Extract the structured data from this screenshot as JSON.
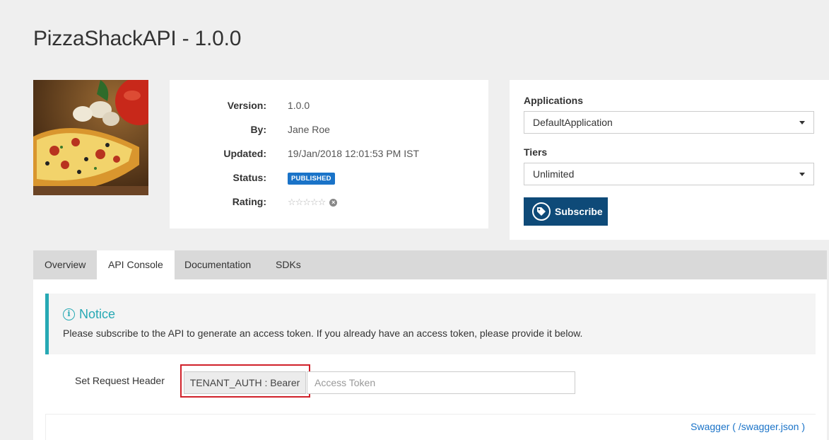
{
  "page": {
    "title": "PizzaShackAPI - 1.0.0"
  },
  "info": {
    "rows": [
      {
        "label": "Version:",
        "value": "1.0.0"
      },
      {
        "label": "By:",
        "value": "Jane Roe"
      },
      {
        "label": "Updated:",
        "value": "19/Jan/2018 12:01:53 PM IST"
      },
      {
        "label": "Status:",
        "value": "PUBLISHED"
      },
      {
        "label": "Rating:",
        "value": "☆☆☆☆☆"
      }
    ],
    "rating_stars": 0,
    "status_color": "#1a73c8"
  },
  "subscribe": {
    "applications_label": "Applications",
    "applications_value": "DefaultApplication",
    "tiers_label": "Tiers",
    "tiers_value": "Unlimited",
    "button_label": "Subscribe",
    "button_color": "#0e4a78"
  },
  "tabs": [
    {
      "label": "Overview",
      "active": false
    },
    {
      "label": "API Console",
      "active": true
    },
    {
      "label": "Documentation",
      "active": false
    },
    {
      "label": "SDKs",
      "active": false
    }
  ],
  "notice": {
    "title": "Notice",
    "text": "Please subscribe to the API to generate an access token. If you already have an access token, please provide it below.",
    "accent_color": "#27a9b4"
  },
  "request_header": {
    "label": "Set Request Header",
    "auth_label": "TENANT_AUTH : Bearer",
    "token_placeholder": "Access Token",
    "token_value": ""
  },
  "swagger": {
    "link_text": "Swagger ( /swagger.json )"
  },
  "icons": {
    "tag": "tag-icon",
    "info": "info-circle-icon",
    "caret": "chevron-down-icon",
    "clear": "clear-rating-icon"
  }
}
